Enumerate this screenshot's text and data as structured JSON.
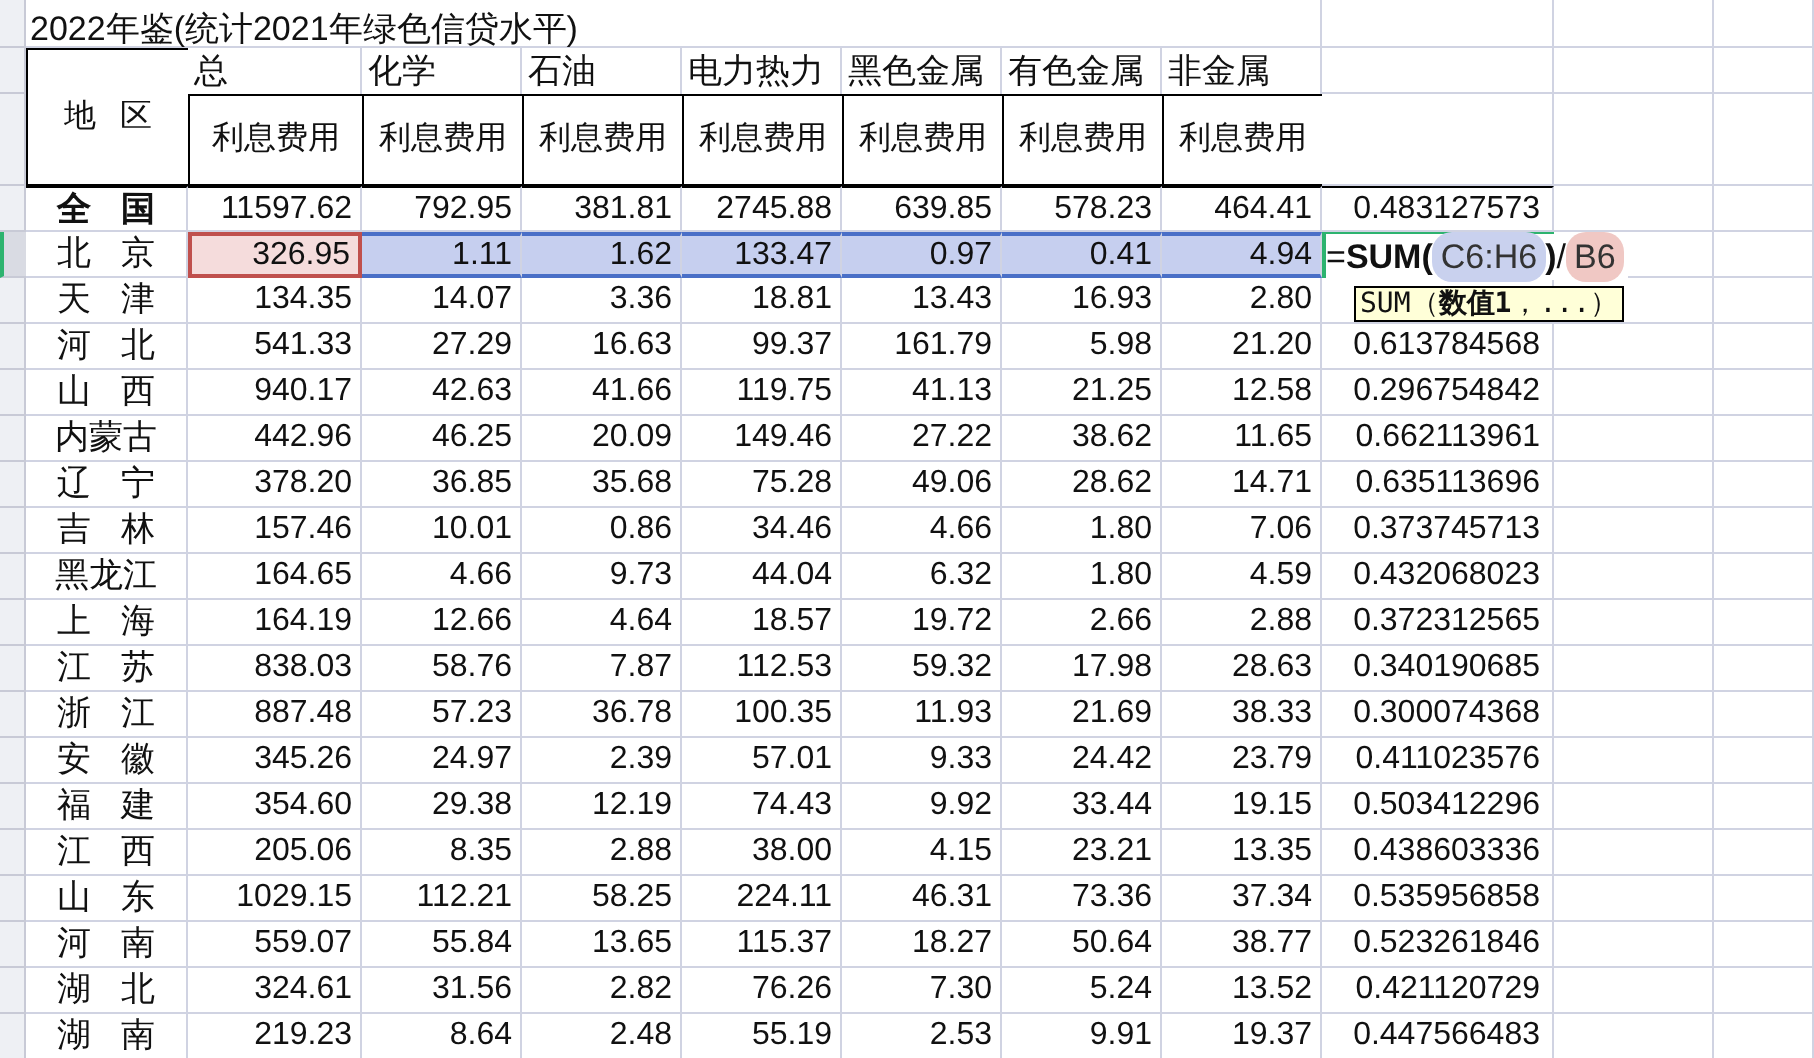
{
  "title": "2022年鉴(统计2021年绿色信贷水平)",
  "header": {
    "region_label": "地 区",
    "columns": [
      {
        "label": "总",
        "sub": "利息费用"
      },
      {
        "label": "化学",
        "sub": "利息费用"
      },
      {
        "label": "石油",
        "sub": "利息费用"
      },
      {
        "label": "电力热力",
        "sub": "利息费用"
      },
      {
        "label": "黑色金属",
        "sub": "利息费用"
      },
      {
        "label": "有色金属",
        "sub": "利息费用"
      },
      {
        "label": "非金属",
        "sub": "利息费用"
      }
    ]
  },
  "rows": [
    {
      "region": "全 国",
      "bold": true,
      "selected": false,
      "values": [
        "11597.62",
        "792.95",
        "381.81",
        "2745.88",
        "639.85",
        "578.23",
        "464.41"
      ],
      "ratio": "0.483127573"
    },
    {
      "region": "北 京",
      "bold": false,
      "selected": true,
      "values": [
        "326.95",
        "1.11",
        "1.62",
        "133.47",
        "0.97",
        "0.41",
        "4.94"
      ],
      "formula": [
        {
          "kind": "plain",
          "text": "="
        },
        {
          "kind": "function",
          "text": "SUM("
        },
        {
          "kind": "reference",
          "text": "C6:H6",
          "color": "#c9d1ee"
        },
        {
          "kind": "function",
          "text": ")"
        },
        {
          "kind": "plain",
          "text": "/"
        },
        {
          "kind": "reference",
          "text": "B6",
          "color": "#f0c8c4"
        }
      ]
    },
    {
      "region": "天 津",
      "bold": false,
      "selected": false,
      "values": [
        "134.35",
        "14.07",
        "3.36",
        "18.81",
        "13.43",
        "16.93",
        "2.80"
      ]
    },
    {
      "region": "河 北",
      "bold": false,
      "selected": false,
      "values": [
        "541.33",
        "27.29",
        "16.63",
        "99.37",
        "161.79",
        "5.98",
        "21.20"
      ],
      "ratio": "0.613784568"
    },
    {
      "region": "山 西",
      "bold": false,
      "selected": false,
      "values": [
        "940.17",
        "42.63",
        "41.66",
        "119.75",
        "41.13",
        "21.25",
        "12.58"
      ],
      "ratio": "0.296754842"
    },
    {
      "region": "内蒙古",
      "bold": false,
      "selected": false,
      "values": [
        "442.96",
        "46.25",
        "20.09",
        "149.46",
        "27.22",
        "38.62",
        "11.65"
      ],
      "ratio": "0.662113961"
    },
    {
      "region": "辽 宁",
      "bold": false,
      "selected": false,
      "values": [
        "378.20",
        "36.85",
        "35.68",
        "75.28",
        "49.06",
        "28.62",
        "14.71"
      ],
      "ratio": "0.635113696"
    },
    {
      "region": "吉 林",
      "bold": false,
      "selected": false,
      "values": [
        "157.46",
        "10.01",
        "0.86",
        "34.46",
        "4.66",
        "1.80",
        "7.06"
      ],
      "ratio": "0.373745713"
    },
    {
      "region": "黑龙江",
      "bold": false,
      "selected": false,
      "values": [
        "164.65",
        "4.66",
        "9.73",
        "44.04",
        "6.32",
        "1.80",
        "4.59"
      ],
      "ratio": "0.432068023"
    },
    {
      "region": "上 海",
      "bold": false,
      "selected": false,
      "values": [
        "164.19",
        "12.66",
        "4.64",
        "18.57",
        "19.72",
        "2.66",
        "2.88"
      ],
      "ratio": "0.372312565"
    },
    {
      "region": "江 苏",
      "bold": false,
      "selected": false,
      "values": [
        "838.03",
        "58.76",
        "7.87",
        "112.53",
        "59.32",
        "17.98",
        "28.63"
      ],
      "ratio": "0.340190685"
    },
    {
      "region": "浙 江",
      "bold": false,
      "selected": false,
      "values": [
        "887.48",
        "57.23",
        "36.78",
        "100.35",
        "11.93",
        "21.69",
        "38.33"
      ],
      "ratio": "0.300074368"
    },
    {
      "region": "安 徽",
      "bold": false,
      "selected": false,
      "values": [
        "345.26",
        "24.97",
        "2.39",
        "57.01",
        "9.33",
        "24.42",
        "23.79"
      ],
      "ratio": "0.411023576"
    },
    {
      "region": "福 建",
      "bold": false,
      "selected": false,
      "values": [
        "354.60",
        "29.38",
        "12.19",
        "74.43",
        "9.92",
        "33.44",
        "19.15"
      ],
      "ratio": "0.503412296"
    },
    {
      "region": "江 西",
      "bold": false,
      "selected": false,
      "values": [
        "205.06",
        "8.35",
        "2.88",
        "38.00",
        "4.15",
        "23.21",
        "13.35"
      ],
      "ratio": "0.438603336"
    },
    {
      "region": "山 东",
      "bold": false,
      "selected": false,
      "values": [
        "1029.15",
        "112.21",
        "58.25",
        "224.11",
        "46.31",
        "73.36",
        "37.34"
      ],
      "ratio": "0.535956858"
    },
    {
      "region": "河 南",
      "bold": false,
      "selected": false,
      "values": [
        "559.07",
        "55.84",
        "13.65",
        "115.37",
        "18.27",
        "50.64",
        "38.77"
      ],
      "ratio": "0.523261846"
    },
    {
      "region": "湖 北",
      "bold": false,
      "selected": false,
      "values": [
        "324.61",
        "31.56",
        "2.82",
        "76.26",
        "7.30",
        "5.24",
        "13.52"
      ],
      "ratio": "0.421120729"
    },
    {
      "region": "湖 南",
      "bold": false,
      "selected": false,
      "values": [
        "219.23",
        "8.64",
        "2.48",
        "55.19",
        "2.53",
        "9.91",
        "19.37"
      ],
      "ratio": "0.447566483"
    }
  ],
  "tooltip": "SUM（**数值1**，...）"
}
